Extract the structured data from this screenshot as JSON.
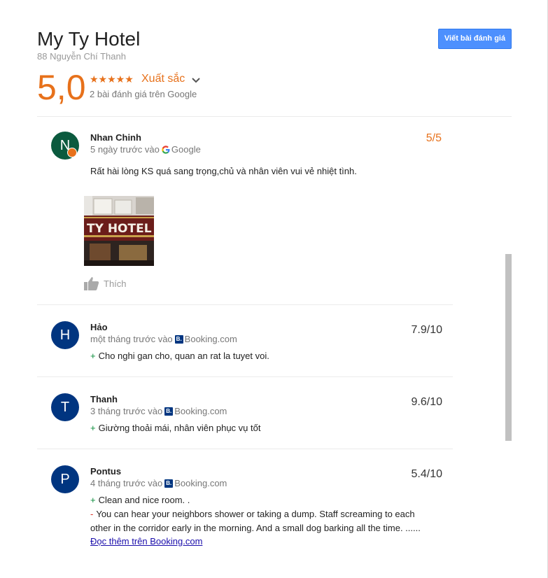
{
  "header": {
    "title": "My Ty Hotel",
    "address": "88 Nguyễn Chí Thanh",
    "write_review_label": "Viết bài đánh giá"
  },
  "summary": {
    "score": "5,0",
    "stars": "★★★★★",
    "rating_word": "Xuất sắc",
    "review_count": "2 bài đánh giá trên Google"
  },
  "reviews": [
    {
      "initial": "N",
      "avatar_color": "#0b5a3e",
      "name": "Nhan Chinh",
      "when": "5 ngày trước vào",
      "source": "Google",
      "score": "5/5",
      "text": "Rất hài lòng KS quá sang trọng,chủ và nhân viên vui vẻ nhiệt tình.",
      "photo_sign": "TY HOTEL",
      "like_label": "Thích"
    },
    {
      "initial": "H",
      "avatar_color": "#003580",
      "name": "Hảo",
      "when": "một tháng trước vào",
      "source": "Booking.com",
      "score": "7.9/10",
      "plus": "Cho nghi gan cho, quan an rat la tuyet voi."
    },
    {
      "initial": "T",
      "avatar_color": "#003580",
      "name": "Thanh",
      "when": "3 tháng trước vào",
      "source": "Booking.com",
      "score": "9.6/10",
      "plus": "Giường thoải mái, nhân viên phục vụ tốt"
    },
    {
      "initial": "P",
      "avatar_color": "#003580",
      "name": "Pontus",
      "when": "4 tháng trước vào",
      "source": "Booking.com",
      "score": "5.4/10",
      "plus": "Clean and nice room. .",
      "minus": "You can hear your neighbors shower or taking a dump. Staff screaming to each other in the corridor early in the morning. And a small dog barking all the time. ......",
      "read_more": "Đọc thêm trên Booking.com"
    }
  ],
  "booking_badge": "B.",
  "colors": {
    "accent": "#e7711b",
    "button_blue": "#4d90fe",
    "booking_blue": "#003580",
    "link": "#1a0dab"
  }
}
